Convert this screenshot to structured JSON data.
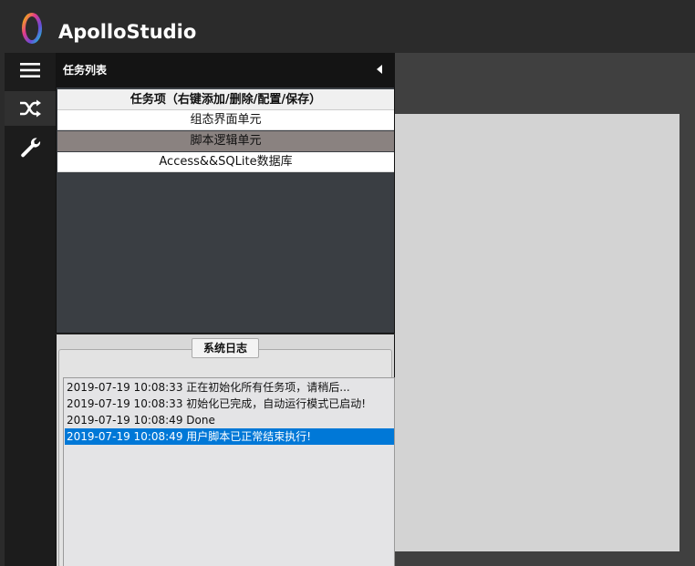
{
  "app": {
    "title": "ApolloStudio",
    "logo_icon": "ring-logo-icon"
  },
  "nav": {
    "items": [
      {
        "icon": "hamburger-menu-icon",
        "active": false
      },
      {
        "icon": "shuffle-icon",
        "active": true
      },
      {
        "icon": "wrench-icon",
        "active": false
      }
    ]
  },
  "task_panel": {
    "title": "任务列表",
    "collapse_icon": "triangle-left-icon",
    "column_header": "任务项（右键添加/删除/配置/保存）",
    "items": [
      {
        "label": "组态界面单元",
        "selected": false
      },
      {
        "label": "脚本逻辑单元",
        "selected": true
      },
      {
        "label": "Access&&SQLite数据库",
        "selected": false
      }
    ]
  },
  "log": {
    "title": "系统日志",
    "lines": [
      {
        "text": "2019-07-19 10:08:33 正在初始化所有任务项，请稍后...",
        "selected": false
      },
      {
        "text": "2019-07-19 10:08:33 初始化已完成，自动运行模式已启动!",
        "selected": false
      },
      {
        "text": "2019-07-19 10:08:49 Done",
        "selected": false
      },
      {
        "text": "2019-07-19 10:08:49 用户脚本已正常结束执行!",
        "selected": true
      }
    ]
  },
  "colors": {
    "background": "#2b2b2b",
    "selection_blue": "#0078d7",
    "selected_task": "#8a8280",
    "canvas": "#d3d3d3"
  }
}
